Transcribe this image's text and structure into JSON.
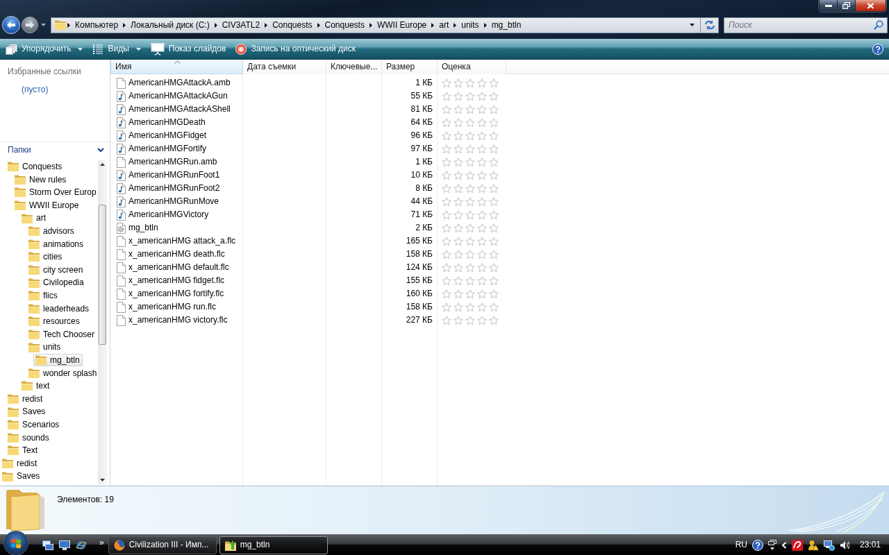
{
  "address_bar": {
    "path": [
      "Компьютер",
      "Локальный диск (C:)",
      "CIV3ATL2",
      "Conquests",
      "Conquests",
      "WWII Europe",
      "art",
      "units",
      "mg_btln"
    ]
  },
  "search": {
    "placeholder": "Поиск"
  },
  "toolbar": [
    {
      "label": "Упорядочить",
      "kind": "menu"
    },
    {
      "label": "Виды",
      "kind": "menu"
    },
    {
      "label": "Показ слайдов",
      "kind": "command"
    },
    {
      "label": "Запись на оптический диск",
      "kind": "command"
    }
  ],
  "sidebar": {
    "favorites": {
      "title": "Избранные ссылки",
      "items": [
        "(пусто)"
      ]
    },
    "folders": {
      "title": "Папки",
      "expanded": true,
      "tree": [
        {
          "children": [
            {
              "label": "Conquests",
              "selected": false,
              "children": [
                {
                  "label": "New rules",
                  "selected": false
                },
                {
                  "label": "Storm Over Europ",
                  "selected": false
                },
                {
                  "label": "WWII Europe",
                  "selected": false,
                  "children": [
                    {
                      "label": "art",
                      "selected": false,
                      "children": [
                        {
                          "label": "advisors",
                          "selected": false
                        },
                        {
                          "label": "animations",
                          "selected": false
                        },
                        {
                          "label": "cities",
                          "selected": false
                        },
                        {
                          "label": "city screen",
                          "selected": false
                        },
                        {
                          "label": "Civilopedia",
                          "selected": false
                        },
                        {
                          "label": "flics",
                          "selected": false
                        },
                        {
                          "label": "leaderheads",
                          "selected": false
                        },
                        {
                          "label": "resources",
                          "selected": false
                        },
                        {
                          "label": "Tech Chooser",
                          "selected": false
                        },
                        {
                          "label": "units",
                          "selected": false,
                          "children": [
                            {
                              "label": "mg_btln",
                              "selected": true
                            }
                          ]
                        },
                        {
                          "label": "wonder splash",
                          "selected": false
                        }
                      ]
                    },
                    {
                      "label": "text",
                      "selected": false
                    }
                  ]
                }
              ]
            },
            {
              "label": "redist",
              "selected": false
            },
            {
              "label": "Saves",
              "selected": false
            },
            {
              "label": "Scenarios",
              "selected": false
            },
            {
              "label": "sounds",
              "selected": false
            },
            {
              "label": "Text",
              "selected": false
            }
          ]
        },
        {
          "label": "redist",
          "selected": false
        },
        {
          "label": "Saves",
          "selected": false
        }
      ]
    }
  },
  "file_list": {
    "columns": [
      {
        "label": "Имя",
        "sorted": true
      },
      {
        "label": "Дата съемки",
        "sorted": false
      },
      {
        "label": "Ключевые...",
        "sorted": false
      },
      {
        "label": "Размер",
        "sorted": false
      },
      {
        "label": "Оценка",
        "sorted": false
      }
    ],
    "rows": [
      {
        "kind": "file",
        "name": "AmericanHMGAttackA.amb",
        "size": "1 КБ",
        "stars": 0
      },
      {
        "kind": "audio",
        "name": "AmericanHMGAttackAGun",
        "size": "55 КБ",
        "stars": 0
      },
      {
        "kind": "audio",
        "name": "AmericanHMGAttackAShell",
        "size": "81 КБ",
        "stars": 0
      },
      {
        "kind": "audio",
        "name": "AmericanHMGDeath",
        "size": "64 КБ",
        "stars": 0
      },
      {
        "kind": "audio",
        "name": "AmericanHMGFidget",
        "size": "96 КБ",
        "stars": 0
      },
      {
        "kind": "audio",
        "name": "AmericanHMGFortify",
        "size": "97 КБ",
        "stars": 0
      },
      {
        "kind": "file",
        "name": "AmericanHMGRun.amb",
        "size": "1 КБ",
        "stars": 0
      },
      {
        "kind": "audio",
        "name": "AmericanHMGRunFoot1",
        "size": "10 КБ",
        "stars": 0
      },
      {
        "kind": "audio",
        "name": "AmericanHMGRunFoot2",
        "size": "8 КБ",
        "stars": 0
      },
      {
        "kind": "audio",
        "name": "AmericanHMGRunMove",
        "size": "44 КБ",
        "stars": 0
      },
      {
        "kind": "audio",
        "name": "AmericanHMGVictory",
        "size": "71 КБ",
        "stars": 0
      },
      {
        "kind": "config",
        "name": "mg_btln",
        "size": "2 КБ",
        "stars": 0
      },
      {
        "kind": "file",
        "name": "x_americanHMG attack_a.flc",
        "size": "165 КБ",
        "stars": 0
      },
      {
        "kind": "file",
        "name": "x_americanHMG death.flc",
        "size": "158 КБ",
        "stars": 0
      },
      {
        "kind": "file",
        "name": "x_americanHMG default.flc",
        "size": "124 КБ",
        "stars": 0
      },
      {
        "kind": "file",
        "name": "x_americanHMG fidget.flc",
        "size": "155 КБ",
        "stars": 0
      },
      {
        "kind": "file",
        "name": "x_americanHMG fortify.flc",
        "size": "160 КБ",
        "stars": 0
      },
      {
        "kind": "file",
        "name": "x_americanHMG run.flc",
        "size": "158 КБ",
        "stars": 0
      },
      {
        "kind": "file",
        "name": "x_americanHMG victory.flc",
        "size": "227 КБ",
        "stars": 0
      }
    ]
  },
  "details_pane": {
    "summary": "Элементов: 19"
  },
  "taskbar": {
    "overflow": "»",
    "buttons": [
      {
        "label": "Civilization III - Имп...",
        "selected": false
      },
      {
        "label": "mg_btln",
        "selected": true
      }
    ],
    "language": "RU",
    "clock": "23:01"
  }
}
